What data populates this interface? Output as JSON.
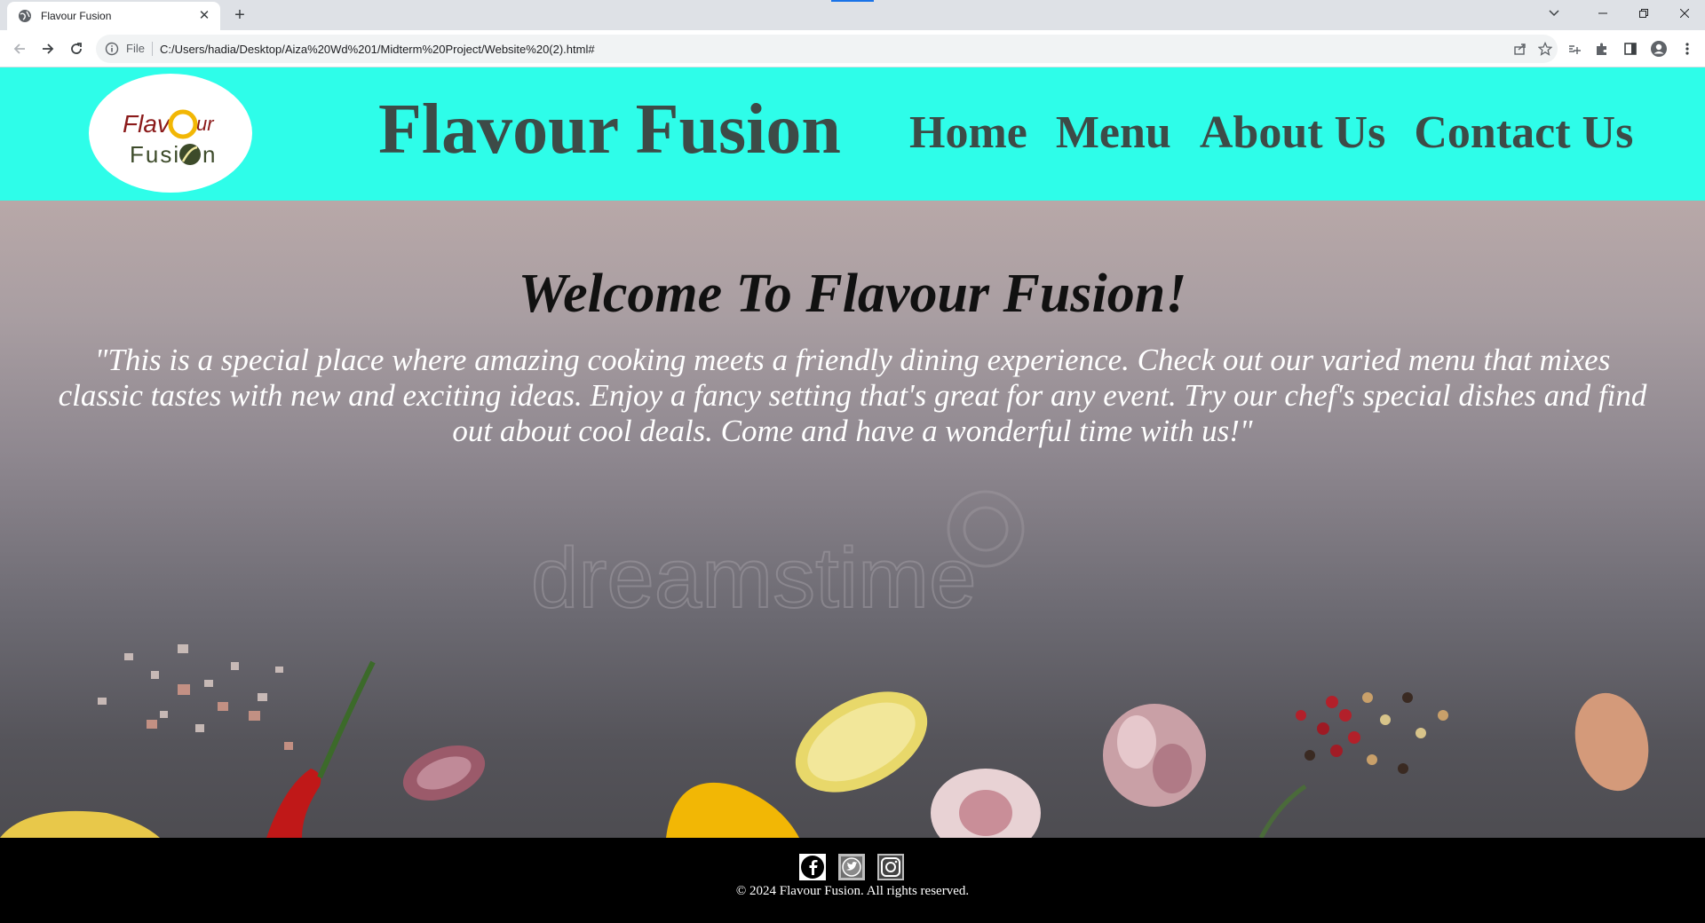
{
  "browser": {
    "tab_title": "Flavour Fusion",
    "url_scheme": "File",
    "url": "C:/Users/hadia/Desktop/Aiza%20Wd%201/Midterm%20Project/Website%20(2).html#"
  },
  "site": {
    "logo_text_line1": "Flav",
    "logo_text_line1b": "ur",
    "logo_text_line2": "Fusi",
    "logo_text_line2b": "n",
    "title": "Flavour Fusion",
    "nav": [
      {
        "label": "Home"
      },
      {
        "label": "Menu"
      },
      {
        "label": "About Us"
      },
      {
        "label": "Contact Us"
      }
    ],
    "colors": {
      "header_bg": "#2efde9",
      "header_text": "#3d4b47",
      "footer_bg": "#000000"
    }
  },
  "hero": {
    "title": "Welcome To Flavour Fusion!",
    "text": "\"This is a special place where amazing cooking meets a friendly dining experience. Check out our varied menu that mixes classic tastes with new and exciting ideas. Enjoy a fancy setting that's great for any event. Try our chef's special dishes and find out about cool deals. Come and have a wonderful time with us!\"",
    "watermark": "dreamstime"
  },
  "footer": {
    "social": [
      {
        "icon": "facebook-icon"
      },
      {
        "icon": "twitter-icon"
      },
      {
        "icon": "instagram-icon"
      }
    ],
    "copyright": "© 2024 Flavour Fusion. All rights reserved."
  }
}
